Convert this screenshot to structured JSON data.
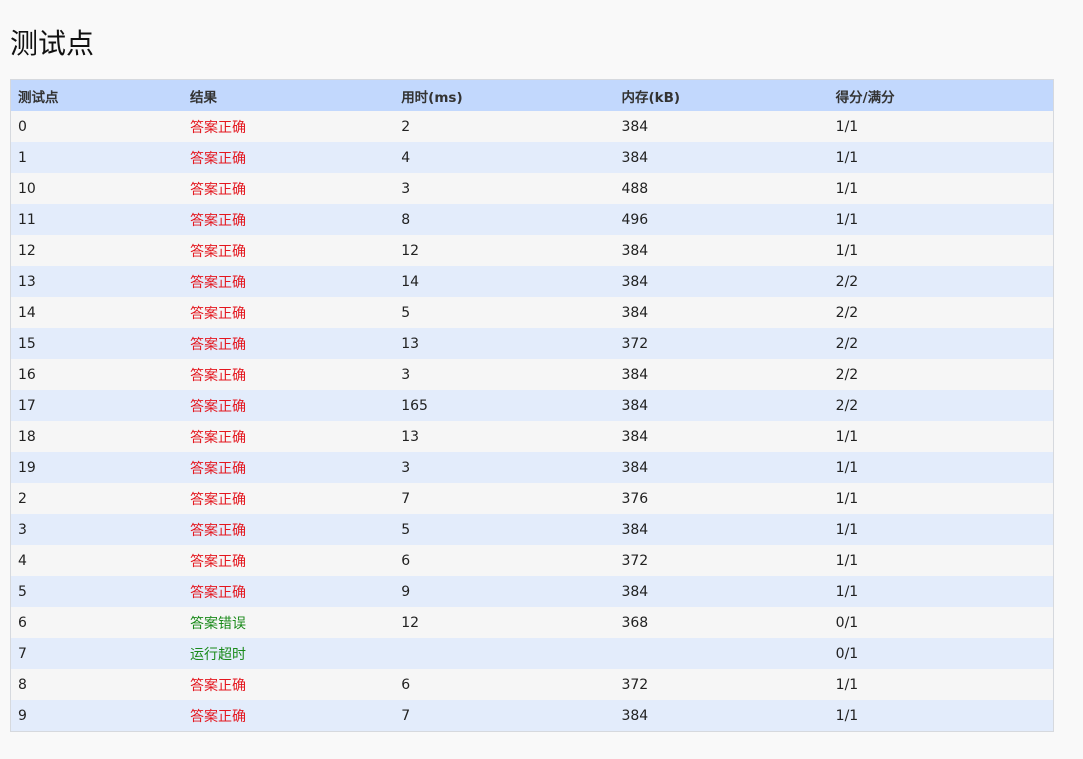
{
  "title": "测试点",
  "colors": {
    "accepted": "#e4161e",
    "other": "#1a8a1a"
  },
  "table": {
    "headers": [
      "测试点",
      "结果",
      "用时(ms)",
      "内存(kB)",
      "得分/满分"
    ],
    "rows": [
      {
        "id": "0",
        "result": "答案正确",
        "status": "ok",
        "time": "2",
        "memory": "384",
        "score": "1/1"
      },
      {
        "id": "1",
        "result": "答案正确",
        "status": "ok",
        "time": "4",
        "memory": "384",
        "score": "1/1"
      },
      {
        "id": "10",
        "result": "答案正确",
        "status": "ok",
        "time": "3",
        "memory": "488",
        "score": "1/1"
      },
      {
        "id": "11",
        "result": "答案正确",
        "status": "ok",
        "time": "8",
        "memory": "496",
        "score": "1/1"
      },
      {
        "id": "12",
        "result": "答案正确",
        "status": "ok",
        "time": "12",
        "memory": "384",
        "score": "1/1"
      },
      {
        "id": "13",
        "result": "答案正确",
        "status": "ok",
        "time": "14",
        "memory": "384",
        "score": "2/2"
      },
      {
        "id": "14",
        "result": "答案正确",
        "status": "ok",
        "time": "5",
        "memory": "384",
        "score": "2/2"
      },
      {
        "id": "15",
        "result": "答案正确",
        "status": "ok",
        "time": "13",
        "memory": "372",
        "score": "2/2"
      },
      {
        "id": "16",
        "result": "答案正确",
        "status": "ok",
        "time": "3",
        "memory": "384",
        "score": "2/2"
      },
      {
        "id": "17",
        "result": "答案正确",
        "status": "ok",
        "time": "165",
        "memory": "384",
        "score": "2/2"
      },
      {
        "id": "18",
        "result": "答案正确",
        "status": "ok",
        "time": "13",
        "memory": "384",
        "score": "1/1"
      },
      {
        "id": "19",
        "result": "答案正确",
        "status": "ok",
        "time": "3",
        "memory": "384",
        "score": "1/1"
      },
      {
        "id": "2",
        "result": "答案正确",
        "status": "ok",
        "time": "7",
        "memory": "376",
        "score": "1/1"
      },
      {
        "id": "3",
        "result": "答案正确",
        "status": "ok",
        "time": "5",
        "memory": "384",
        "score": "1/1"
      },
      {
        "id": "4",
        "result": "答案正确",
        "status": "ok",
        "time": "6",
        "memory": "372",
        "score": "1/1"
      },
      {
        "id": "5",
        "result": "答案正确",
        "status": "ok",
        "time": "9",
        "memory": "384",
        "score": "1/1"
      },
      {
        "id": "6",
        "result": "答案错误",
        "status": "bad",
        "time": "12",
        "memory": "368",
        "score": "0/1"
      },
      {
        "id": "7",
        "result": "运行超时",
        "status": "bad",
        "time": "",
        "memory": "",
        "score": "0/1"
      },
      {
        "id": "8",
        "result": "答案正确",
        "status": "ok",
        "time": "6",
        "memory": "372",
        "score": "1/1"
      },
      {
        "id": "9",
        "result": "答案正确",
        "status": "ok",
        "time": "7",
        "memory": "384",
        "score": "1/1"
      }
    ]
  }
}
